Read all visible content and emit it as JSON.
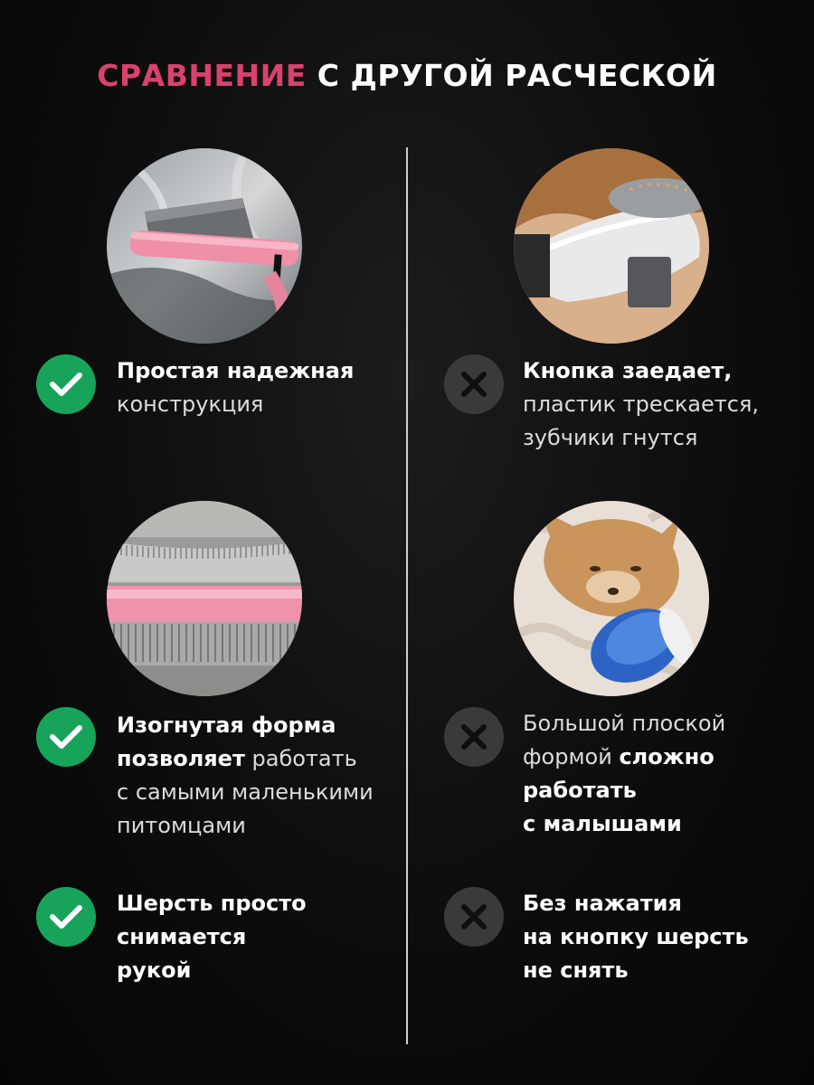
{
  "header": {
    "title_accent": "СРАВНЕНИЕ",
    "title_rest": " С ДРУГОЙ РАСЧЕСКОЙ",
    "accent_color": "#d9426d"
  },
  "left": {
    "icon": "check-icon",
    "color": "#17a35a",
    "item1": {
      "bold": "Простая надежная",
      "normal": "конструкция"
    },
    "item2": {
      "bold1": "Изогнутая форма",
      "bold2": "позволяет",
      "normal2": " работать",
      "normal3": "с самыми маленькими",
      "normal4": "питомцами"
    },
    "item3": {
      "line1": "Шерсть просто",
      "line2": "снимается",
      "line3": "рукой"
    }
  },
  "right": {
    "icon": "cross-icon",
    "color": "#3a3a3a",
    "item1": {
      "bold": "Кнопка заедает,",
      "normal1": "пластик трескается,",
      "normal2": "зубчики гнутся"
    },
    "item2": {
      "normal1": "Большой плоской",
      "normal2": "формой ",
      "bold2": "сложно",
      "bold3": "работать",
      "bold4": "с малышами"
    },
    "item3": {
      "line1": "Без нажатия",
      "line2": "на кнопку шерсть",
      "line3": "не снять"
    }
  }
}
